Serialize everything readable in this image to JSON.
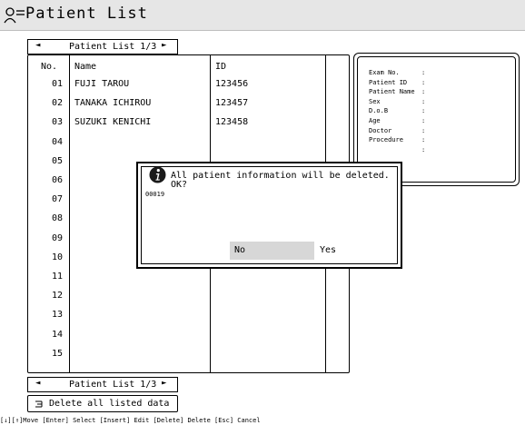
{
  "title": "Patient List",
  "pager_top": {
    "label": "Patient List 1/3",
    "prev": "◄",
    "next": "►"
  },
  "pager_bottom": {
    "label": "Patient List 1/3",
    "prev": "◄",
    "next": "►"
  },
  "table": {
    "headers": {
      "no": "No.",
      "name": "Name",
      "id": "ID"
    },
    "rows": [
      {
        "no": "01",
        "name": "FUJI TAROU",
        "id": "123456"
      },
      {
        "no": "02",
        "name": "TANAKA ICHIROU",
        "id": "123457"
      },
      {
        "no": "03",
        "name": "SUZUKI KENICHI",
        "id": "123458"
      },
      {
        "no": "04",
        "name": "",
        "id": ""
      },
      {
        "no": "05",
        "name": "",
        "id": ""
      },
      {
        "no": "06",
        "name": "",
        "id": ""
      },
      {
        "no": "07",
        "name": "",
        "id": ""
      },
      {
        "no": "08",
        "name": "",
        "id": ""
      },
      {
        "no": "09",
        "name": "",
        "id": ""
      },
      {
        "no": "10",
        "name": "",
        "id": ""
      },
      {
        "no": "11",
        "name": "",
        "id": ""
      },
      {
        "no": "12",
        "name": "",
        "id": ""
      },
      {
        "no": "13",
        "name": "",
        "id": ""
      },
      {
        "no": "14",
        "name": "",
        "id": ""
      },
      {
        "no": "15",
        "name": "",
        "id": ""
      }
    ]
  },
  "info_panel": {
    "fields": [
      {
        "label": "Exam No.",
        "colon": ":"
      },
      {
        "label": "Patient ID",
        "colon": ":"
      },
      {
        "label": "Patient Name",
        "colon": ":"
      },
      {
        "label": "Sex",
        "colon": ":"
      },
      {
        "label": "D.o.B",
        "colon": ":"
      },
      {
        "label": "Age",
        "colon": ":"
      },
      {
        "label": "Doctor",
        "colon": ":"
      },
      {
        "label": "Procedure",
        "colon": ":"
      },
      {
        "label": "",
        "colon": ":"
      }
    ]
  },
  "dialog": {
    "message": "All patient information will be deleted.\nOK?",
    "code": "00019",
    "no_label": "No",
    "yes_label": "Yes",
    "icon": "info-icon"
  },
  "delete_all": {
    "icon": "list-delete-icon",
    "label": "Delete all listed data"
  },
  "statusbar": "[↓][↑]Move [Enter] Select [Insert] Edit [Delete] Delete [Esc] Cancel"
}
